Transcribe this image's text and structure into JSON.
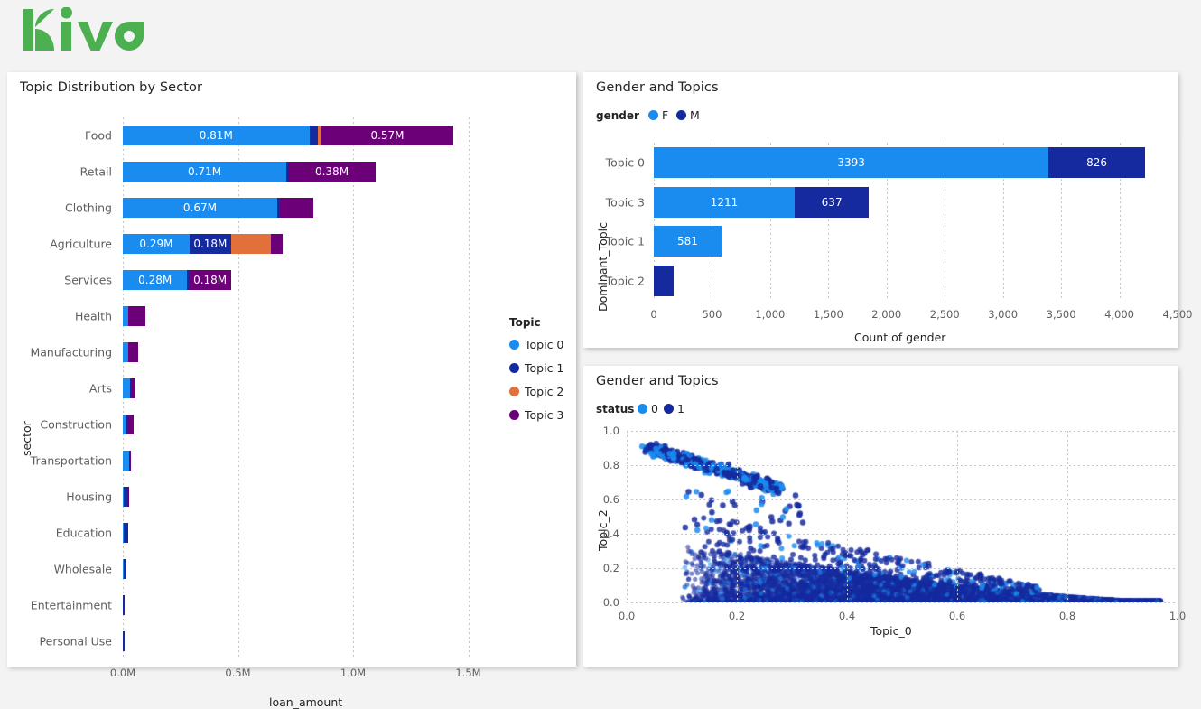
{
  "brand": {
    "name": "kiva",
    "color": "#4caf50"
  },
  "panels": {
    "left": {
      "title": "Topic Distribution by Sector"
    },
    "topright": {
      "title": "Gender and Topics"
    },
    "botright": {
      "title": "Gender and Topics"
    }
  },
  "topic_colors": {
    "topic0": "#1a8cf0",
    "topic1": "#152a9e",
    "topic2": "#e2703a",
    "topic3": "#6b0079"
  },
  "left_legend": {
    "title": "Topic",
    "items": [
      {
        "label": "Topic 0",
        "color": "#1a8cf0"
      },
      {
        "label": "Topic 1",
        "color": "#152a9e"
      },
      {
        "label": "Topic 2",
        "color": "#e2703a"
      },
      {
        "label": "Topic 3",
        "color": "#6b0079"
      }
    ]
  },
  "gender_legend": {
    "title": "gender",
    "items": [
      {
        "label": "F",
        "color": "#1a8cf0"
      },
      {
        "label": "M",
        "color": "#152a9e"
      }
    ]
  },
  "status_legend": {
    "title": "status",
    "items": [
      {
        "label": "0",
        "color": "#1a8cf0"
      },
      {
        "label": "1",
        "color": "#152a9e"
      }
    ]
  },
  "chart_data": [
    {
      "id": "topic-distribution-by-sector",
      "type": "bar",
      "orientation": "horizontal",
      "stacked": true,
      "title": "Topic Distribution by Sector",
      "xlabel": "loan_amount",
      "ylabel": "sector",
      "xlim": [
        0,
        1.6
      ],
      "xticks": [
        0.0,
        0.5,
        1.0,
        1.5
      ],
      "xticklabels": [
        "0.0M",
        "0.5M",
        "1.0M",
        "1.5M"
      ],
      "grid": true,
      "legend_position": "right",
      "series_names": [
        "Topic 0",
        "Topic 1",
        "Topic 2",
        "Topic 3"
      ],
      "series_colors": [
        "#1a8cf0",
        "#152a9e",
        "#e2703a",
        "#6b0079"
      ],
      "categories": [
        "Food",
        "Retail",
        "Clothing",
        "Agriculture",
        "Services",
        "Health",
        "Manufacturing",
        "Arts",
        "Construction",
        "Transportation",
        "Housing",
        "Education",
        "Wholesale",
        "Entertainment",
        "Personal Use"
      ],
      "rows": [
        {
          "category": "Food",
          "values": [
            0.81,
            0.038,
            0.016,
            0.57
          ],
          "labels": [
            "0.81M",
            "",
            "",
            "0.57M"
          ]
        },
        {
          "category": "Retail",
          "values": [
            0.71,
            0.008,
            0.0,
            0.38
          ],
          "labels": [
            "0.71M",
            "",
            "",
            "0.38M"
          ]
        },
        {
          "category": "Clothing",
          "values": [
            0.67,
            0.014,
            0.0,
            0.145
          ],
          "labels": [
            "0.67M",
            "",
            "",
            ""
          ]
        },
        {
          "category": "Agriculture",
          "values": [
            0.29,
            0.18,
            0.175,
            0.048
          ],
          "labels": [
            "0.29M",
            "0.18M",
            "",
            ""
          ]
        },
        {
          "category": "Services",
          "values": [
            0.28,
            0.009,
            0.0,
            0.18
          ],
          "labels": [
            "0.28M",
            "",
            "",
            "0.18M"
          ]
        },
        {
          "category": "Health",
          "values": [
            0.022,
            0.0,
            0.0,
            0.076
          ],
          "labels": [
            "",
            "",
            "",
            ""
          ]
        },
        {
          "category": "Manufacturing",
          "values": [
            0.022,
            0.002,
            0.0,
            0.044
          ],
          "labels": [
            "",
            "",
            "",
            ""
          ]
        },
        {
          "category": "Arts",
          "values": [
            0.032,
            0.004,
            0.0,
            0.018
          ],
          "labels": [
            "",
            "",
            "",
            ""
          ]
        },
        {
          "category": "Construction",
          "values": [
            0.014,
            0.006,
            0.0,
            0.026
          ],
          "labels": [
            "",
            "",
            "",
            ""
          ]
        },
        {
          "category": "Transportation",
          "values": [
            0.026,
            0.002,
            0.0,
            0.008
          ],
          "labels": [
            "",
            "",
            "",
            ""
          ]
        },
        {
          "category": "Housing",
          "values": [
            0.004,
            0.02,
            0.0,
            0.002
          ],
          "labels": [
            "",
            "",
            "",
            ""
          ]
        },
        {
          "category": "Education",
          "values": [
            0.004,
            0.014,
            0.0,
            0.002
          ],
          "labels": [
            "",
            "",
            "",
            ""
          ]
        },
        {
          "category": "Wholesale",
          "values": [
            0.002,
            0.01,
            0.0,
            0.002
          ],
          "labels": [
            "",
            "",
            "",
            ""
          ]
        },
        {
          "category": "Entertainment",
          "values": [
            0.001,
            0.004,
            0.0,
            0.001
          ],
          "labels": [
            "",
            "",
            "",
            ""
          ]
        },
        {
          "category": "Personal Use",
          "values": [
            0.001,
            0.001,
            0.0,
            0.004
          ],
          "labels": [
            "",
            "",
            "",
            ""
          ]
        }
      ]
    },
    {
      "id": "gender-and-topics-bar",
      "type": "bar",
      "orientation": "horizontal",
      "stacked": true,
      "title": "Gender and Topics",
      "xlabel": "Count of gender",
      "ylabel": "Dominant_Topic",
      "xlim": [
        0,
        4500
      ],
      "xticks": [
        0,
        500,
        1000,
        1500,
        2000,
        2500,
        3000,
        3500,
        4000,
        4500
      ],
      "xticklabels": [
        "0",
        "500",
        "1,000",
        "1,500",
        "2,000",
        "2,500",
        "3,000",
        "3,500",
        "4,000",
        "4,500"
      ],
      "grid": true,
      "legend_position": "top",
      "series_names": [
        "F",
        "M"
      ],
      "series_colors": [
        "#1a8cf0",
        "#152a9e"
      ],
      "categories": [
        "Topic 0",
        "Topic 3",
        "Topic 1",
        "Topic 2"
      ],
      "rows": [
        {
          "category": "Topic 0",
          "values": [
            3393,
            826
          ],
          "labels": [
            "3393",
            "826"
          ]
        },
        {
          "category": "Topic 3",
          "values": [
            1211,
            637
          ],
          "labels": [
            "1211",
            "637"
          ]
        },
        {
          "category": "Topic 1",
          "values": [
            581,
            0
          ],
          "labels": [
            "581",
            ""
          ]
        },
        {
          "category": "Topic 2",
          "values": [
            0,
            173
          ],
          "labels": [
            "",
            ""
          ]
        }
      ]
    },
    {
      "id": "gender-and-topics-scatter",
      "type": "scatter",
      "title": "Gender and Topics",
      "xlabel": "Topic_0",
      "ylabel": "Topic_2",
      "xlim": [
        0.0,
        1.0
      ],
      "ylim": [
        0.0,
        1.0
      ],
      "xticks": [
        0.0,
        0.2,
        0.4,
        0.6,
        0.8,
        1.0
      ],
      "xticklabels": [
        "0.0",
        "0.2",
        "0.4",
        "0.6",
        "0.8",
        "1.0"
      ],
      "yticks": [
        0.0,
        0.2,
        0.4,
        0.6,
        0.8,
        1.0
      ],
      "yticklabels": [
        "0.0",
        "0.2",
        "0.4",
        "0.6",
        "0.8",
        "1.0"
      ],
      "grid": true,
      "legend_position": "top",
      "series": [
        {
          "name": "0",
          "color": "#1a8cf0"
        },
        {
          "name": "1",
          "color": "#152a9e"
        }
      ],
      "description": "Two clusters: an upper-left diagonal band (Topic_0 0.03-0.30, Topic_2 0.60-0.92) and a dense wedge along the bottom running from Topic_0 0.10 to 0.97 with Topic_2 decreasing from ~0.35 to ~0.0"
    }
  ]
}
